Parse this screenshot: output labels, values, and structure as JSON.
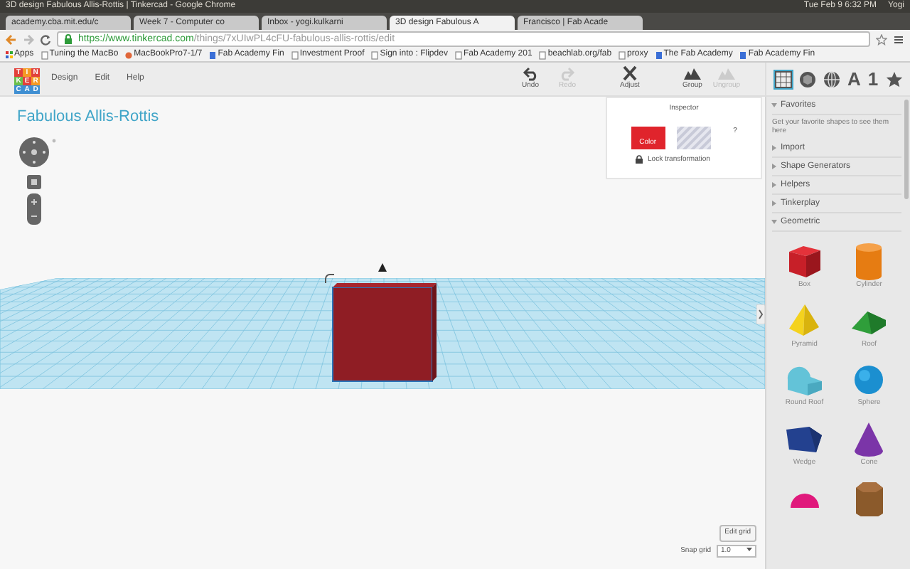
{
  "os_bar": {
    "title": "3D design Fabulous Allis-Rottis | Tinkercad - Google Chrome",
    "clock": "Tue Feb 9 6:32 PM",
    "user": "Yogi"
  },
  "browser_tabs": [
    {
      "label": "academy.cba.mit.edu/c",
      "selected": false
    },
    {
      "label": "Week 7 - Computer co",
      "selected": false
    },
    {
      "label": "Inbox - yogi.kulkarni",
      "selected": false
    },
    {
      "label": "3D design Fabulous A",
      "selected": true
    },
    {
      "label": "Francisco | Fab Acade",
      "selected": false
    }
  ],
  "address_bar": {
    "secure_part": "https://www.tinkercad.com",
    "path": "/things/7xUIwPL4cFU-fabulous-allis-rottis/edit"
  },
  "bookmarks": [
    {
      "label": "Apps",
      "kind": "apps"
    },
    {
      "label": "Tuning the MacBo",
      "kind": "page"
    },
    {
      "label": "MacBookPro7-1/7",
      "kind": "apple"
    },
    {
      "label": "Fab Academy Fin",
      "kind": "doc"
    },
    {
      "label": "Investment Proof",
      "kind": "page"
    },
    {
      "label": "Sign into : Flipdev",
      "kind": "page"
    },
    {
      "label": "Fab Academy 201",
      "kind": "page"
    },
    {
      "label": "beachlab.org/fab",
      "kind": "page"
    },
    {
      "label": "proxy",
      "kind": "page"
    },
    {
      "label": "The Fab Academy",
      "kind": "doc"
    },
    {
      "label": "Fab Academy Fin",
      "kind": "doc"
    }
  ],
  "logo_letters": [
    {
      "letter": "T",
      "color": "#e2413a"
    },
    {
      "letter": "I",
      "color": "#f49a24"
    },
    {
      "letter": "N",
      "color": "#e2413a"
    },
    {
      "letter": "K",
      "color": "#6bbf4b"
    },
    {
      "letter": "E",
      "color": "#e2413a"
    },
    {
      "letter": "R",
      "color": "#f49a24"
    },
    {
      "letter": "C",
      "color": "#3f8fd2"
    },
    {
      "letter": "A",
      "color": "#3f8fd2"
    },
    {
      "letter": "D",
      "color": "#3f8fd2"
    }
  ],
  "app_menu": [
    "Design",
    "Edit",
    "Help"
  ],
  "tools": [
    {
      "label": "Undo",
      "kind": "undo",
      "disabled": false
    },
    {
      "label": "Redo",
      "kind": "redo",
      "disabled": true
    },
    {
      "label": "Adjust",
      "kind": "adjust",
      "disabled": false
    },
    {
      "label": "Group",
      "kind": "group",
      "disabled": false
    },
    {
      "label": "Ungroup",
      "kind": "ungroup",
      "disabled": true
    }
  ],
  "panel_tabs": [
    {
      "kind": "grid",
      "selected": true
    },
    {
      "kind": "shape",
      "selected": false
    },
    {
      "kind": "globe",
      "selected": false
    },
    {
      "kind": "text",
      "label": "A",
      "selected": false
    },
    {
      "kind": "text",
      "label": "1",
      "selected": false
    },
    {
      "kind": "star",
      "selected": false
    }
  ],
  "design_title": "Fabulous Allis-Rottis",
  "inspector": {
    "title": "Inspector",
    "solid_label": "Color",
    "help": "?",
    "lock_label": "Lock transformation"
  },
  "grid_controls": {
    "edit_button": "Edit grid",
    "snap_label": "Snap grid",
    "snap_value": "1.0"
  },
  "categories": [
    {
      "label": "Favorites",
      "expanded": true,
      "note": "Get your favorite shapes to see them here"
    },
    {
      "label": "Import",
      "expanded": false
    },
    {
      "label": "Shape Generators",
      "expanded": false
    },
    {
      "label": "Helpers",
      "expanded": false
    },
    {
      "label": "Tinkerplay",
      "expanded": false
    },
    {
      "label": "Geometric",
      "expanded": true
    }
  ],
  "shapes": [
    {
      "kind": "box",
      "label": "Box"
    },
    {
      "kind": "cylinder",
      "label": "Cylinder"
    },
    {
      "kind": "pyramid",
      "label": "Pyramid"
    },
    {
      "kind": "roof",
      "label": "Roof"
    },
    {
      "kind": "round-roof",
      "label": "Round Roof"
    },
    {
      "kind": "sphere",
      "label": "Sphere"
    },
    {
      "kind": "wedge",
      "label": "Wedge"
    },
    {
      "kind": "cone",
      "label": "Cone"
    },
    {
      "kind": "half-sphere"
    },
    {
      "kind": "hex-prism"
    }
  ]
}
